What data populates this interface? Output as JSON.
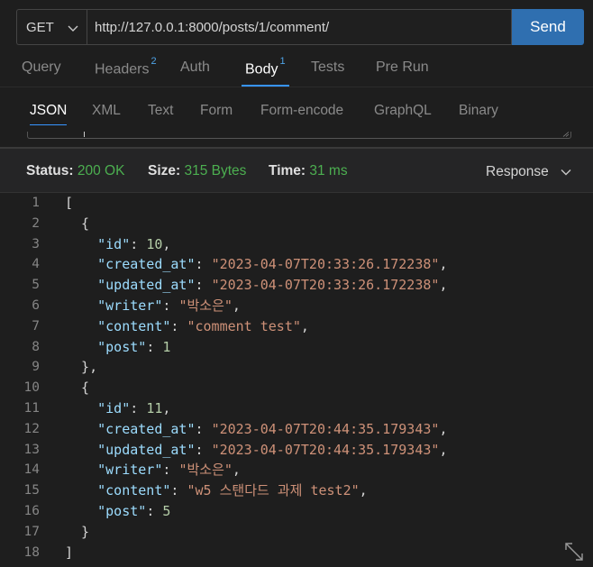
{
  "request": {
    "method": "GET",
    "url": "http://127.0.0.1:8000/posts/1/comment/",
    "send_label": "Send"
  },
  "tabs": [
    {
      "label": "Query",
      "badge": ""
    },
    {
      "label": "Headers",
      "badge": "2"
    },
    {
      "label": "Auth",
      "badge": ""
    },
    {
      "label": "Body",
      "badge": "1"
    },
    {
      "label": "Tests",
      "badge": ""
    },
    {
      "label": "Pre Run",
      "badge": ""
    }
  ],
  "body_tabs": [
    "JSON",
    "XML",
    "Text",
    "Form",
    "Form-encode",
    "GraphQL",
    "Binary"
  ],
  "status": {
    "status_label": "Status:",
    "status_value": "200 OK",
    "size_label": "Size:",
    "size_value": "315 Bytes",
    "time_label": "Time:",
    "time_value": "31 ms",
    "view_select": "Response"
  },
  "lines": [
    {
      "no": "1",
      "tokens": [
        {
          "t": "[",
          "c": "p"
        }
      ]
    },
    {
      "no": "2",
      "tokens": [
        {
          "t": "  {",
          "c": "p"
        }
      ]
    },
    {
      "no": "3",
      "tokens": [
        {
          "t": "    ",
          "c": "p"
        },
        {
          "t": "\"id\"",
          "c": "k"
        },
        {
          "t": ": ",
          "c": "p"
        },
        {
          "t": "10",
          "c": "n"
        },
        {
          "t": ",",
          "c": "p"
        }
      ]
    },
    {
      "no": "4",
      "tokens": [
        {
          "t": "    ",
          "c": "p"
        },
        {
          "t": "\"created_at\"",
          "c": "k"
        },
        {
          "t": ": ",
          "c": "p"
        },
        {
          "t": "\"2023-04-07T20:33:26.172238\"",
          "c": "s"
        },
        {
          "t": ",",
          "c": "p"
        }
      ]
    },
    {
      "no": "5",
      "tokens": [
        {
          "t": "    ",
          "c": "p"
        },
        {
          "t": "\"updated_at\"",
          "c": "k"
        },
        {
          "t": ": ",
          "c": "p"
        },
        {
          "t": "\"2023-04-07T20:33:26.172238\"",
          "c": "s"
        },
        {
          "t": ",",
          "c": "p"
        }
      ]
    },
    {
      "no": "6",
      "tokens": [
        {
          "t": "    ",
          "c": "p"
        },
        {
          "t": "\"writer\"",
          "c": "k"
        },
        {
          "t": ": ",
          "c": "p"
        },
        {
          "t": "\"박소은\"",
          "c": "s"
        },
        {
          "t": ",",
          "c": "p"
        }
      ]
    },
    {
      "no": "7",
      "tokens": [
        {
          "t": "    ",
          "c": "p"
        },
        {
          "t": "\"content\"",
          "c": "k"
        },
        {
          "t": ": ",
          "c": "p"
        },
        {
          "t": "\"comment test\"",
          "c": "s"
        },
        {
          "t": ",",
          "c": "p"
        }
      ]
    },
    {
      "no": "8",
      "tokens": [
        {
          "t": "    ",
          "c": "p"
        },
        {
          "t": "\"post\"",
          "c": "k"
        },
        {
          "t": ": ",
          "c": "p"
        },
        {
          "t": "1",
          "c": "n"
        }
      ]
    },
    {
      "no": "9",
      "tokens": [
        {
          "t": "  },",
          "c": "p"
        }
      ]
    },
    {
      "no": "10",
      "tokens": [
        {
          "t": "  {",
          "c": "p"
        }
      ]
    },
    {
      "no": "11",
      "tokens": [
        {
          "t": "    ",
          "c": "p"
        },
        {
          "t": "\"id\"",
          "c": "k"
        },
        {
          "t": ": ",
          "c": "p"
        },
        {
          "t": "11",
          "c": "n"
        },
        {
          "t": ",",
          "c": "p"
        }
      ]
    },
    {
      "no": "12",
      "tokens": [
        {
          "t": "    ",
          "c": "p"
        },
        {
          "t": "\"created_at\"",
          "c": "k"
        },
        {
          "t": ": ",
          "c": "p"
        },
        {
          "t": "\"2023-04-07T20:44:35.179343\"",
          "c": "s"
        },
        {
          "t": ",",
          "c": "p"
        }
      ]
    },
    {
      "no": "13",
      "tokens": [
        {
          "t": "    ",
          "c": "p"
        },
        {
          "t": "\"updated_at\"",
          "c": "k"
        },
        {
          "t": ": ",
          "c": "p"
        },
        {
          "t": "\"2023-04-07T20:44:35.179343\"",
          "c": "s"
        },
        {
          "t": ",",
          "c": "p"
        }
      ]
    },
    {
      "no": "14",
      "tokens": [
        {
          "t": "    ",
          "c": "p"
        },
        {
          "t": "\"writer\"",
          "c": "k"
        },
        {
          "t": ": ",
          "c": "p"
        },
        {
          "t": "\"박소은\"",
          "c": "s"
        },
        {
          "t": ",",
          "c": "p"
        }
      ]
    },
    {
      "no": "15",
      "tokens": [
        {
          "t": "    ",
          "c": "p"
        },
        {
          "t": "\"content\"",
          "c": "k"
        },
        {
          "t": ": ",
          "c": "p"
        },
        {
          "t": "\"w5 스탠다드 과제 test2\"",
          "c": "s"
        },
        {
          "t": ",",
          "c": "p"
        }
      ]
    },
    {
      "no": "16",
      "tokens": [
        {
          "t": "    ",
          "c": "p"
        },
        {
          "t": "\"post\"",
          "c": "k"
        },
        {
          "t": ": ",
          "c": "p"
        },
        {
          "t": "5",
          "c": "n"
        }
      ]
    },
    {
      "no": "17",
      "tokens": [
        {
          "t": "  }",
          "c": "p"
        }
      ]
    },
    {
      "no": "18",
      "tokens": [
        {
          "t": "]",
          "c": "p"
        }
      ]
    }
  ],
  "colors": {
    "accent": "#3794ff",
    "send_button": "#2f6fb0",
    "status_ok": "#4caf50",
    "json_key": "#9cdcfe",
    "json_string": "#ce9178",
    "json_number": "#b5cea8"
  },
  "icons": {
    "method_dropdown": "chevron-down-icon",
    "response_dropdown": "chevron-down-icon",
    "expand": "expand-icon"
  }
}
